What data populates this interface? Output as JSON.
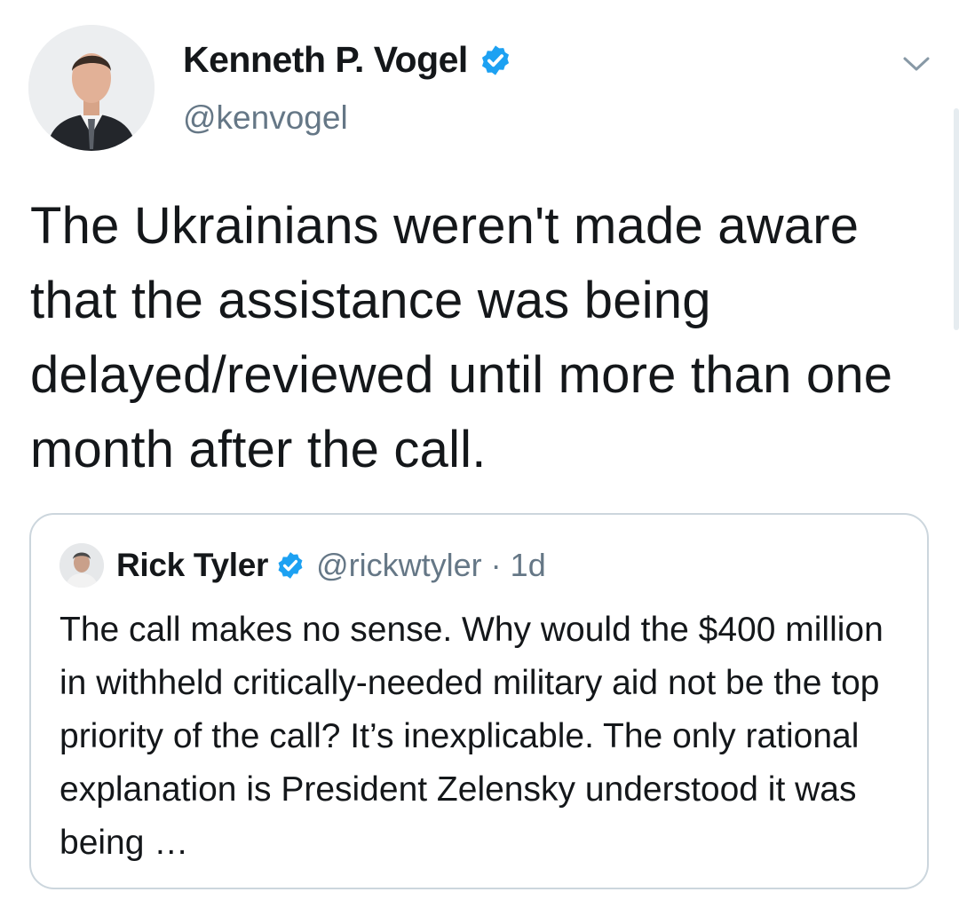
{
  "author": {
    "display_name": "Kenneth P. Vogel",
    "handle": "@kenvogel",
    "verified": true,
    "avatar_icon": "profile-photo"
  },
  "tweet": {
    "text": "The Ukrainians weren't made aware that the assistance was being delayed/reviewed until more than one month after the call."
  },
  "menu": {
    "icon": "chevron-down-icon"
  },
  "quoted_tweet": {
    "display_name": "Rick Tyler",
    "handle": "@rickwtyler",
    "separator": "·",
    "time": "1d",
    "verified": true,
    "text": "The call makes no sense. Why would the $400 million in withheld critically-needed military aid not be the top priority of the call? It’s inexplicable. The only rational explanation is President Zelensky understood it was being …"
  },
  "colors": {
    "text": "#14171a",
    "secondary": "#657786",
    "verified_blue": "#1da1f2",
    "border": "#ccd6dd"
  }
}
